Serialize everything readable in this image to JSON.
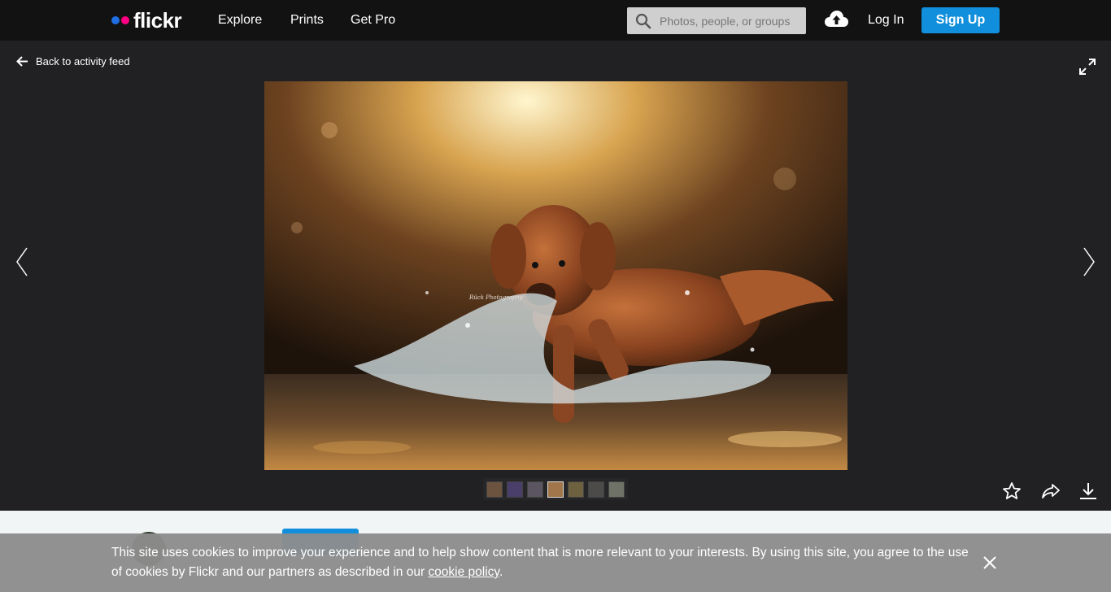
{
  "header": {
    "logo_text": "flickr",
    "nav": [
      {
        "label": "Explore"
      },
      {
        "label": "Prints"
      },
      {
        "label": "Get Pro"
      }
    ],
    "search_placeholder": "Photos, people, or groups",
    "login_label": "Log In",
    "signup_label": "Sign Up"
  },
  "viewer": {
    "back_label": "Back to activity feed",
    "photo_watermark": "Rück Photography",
    "thumbnail_count": 7
  },
  "cookie_banner": {
    "text_before": "This site uses cookies to improve your experience and to help show content that is more relevant to your interests. By using this site, you agree to the use of cookies by Flickr and our partners as described in our ",
    "link_text": "cookie policy",
    "text_after": "."
  },
  "colors": {
    "topbar": "#121212",
    "viewer_bg": "#212124",
    "accent_blue": "#128fdc",
    "logo_blue": "#1f6ee4",
    "logo_pink": "#ff0084"
  }
}
